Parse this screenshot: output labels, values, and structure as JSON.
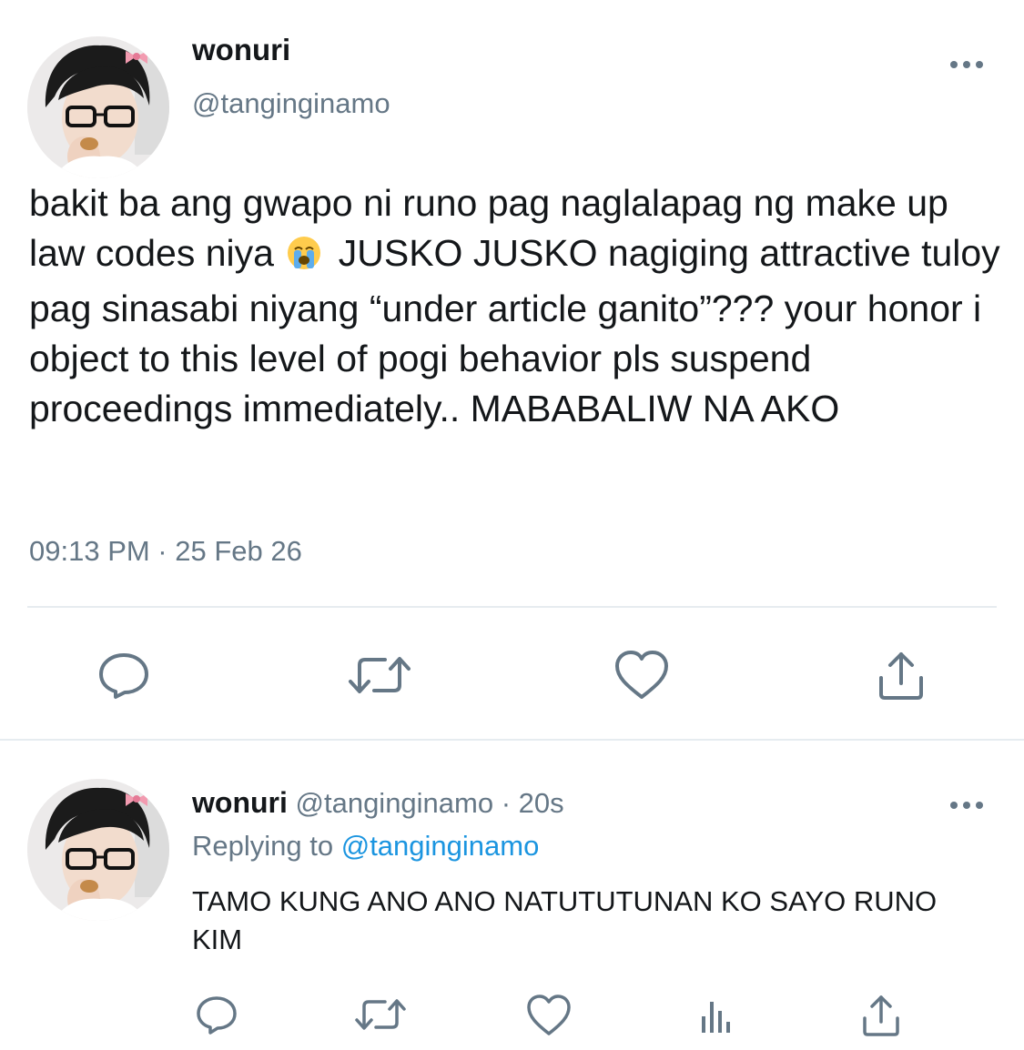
{
  "main_tweet": {
    "display_name": "wonuri",
    "handle": "@tanginginamo",
    "text_before_emoji": "bakit ba ang gwapo ni runo pag naglalapag ng make up law codes niya",
    "emoji": "😭",
    "text_after_emoji": "JUSKO JUSKO nagiging attractive tuloy pag sinasabi niyang “under article ganito”??? your honor i object to this level of pogi behavior pls suspend proceedings immediately.. MABABALIW NA AKO",
    "timestamp": "09:13 PM · 25 Feb 26"
  },
  "reply_tweet": {
    "display_name": "wonuri",
    "handle": "@tanginginamo",
    "separator_time": "· 20s",
    "replying_to_label": "Replying to",
    "replying_to_handle": "@tanginginamo",
    "text": "TAMO KUNG ANO ANO NATUTUTUNAN KO SAYO RUNO KIM"
  },
  "icons": {
    "more": "more-horizontal-icon",
    "reply": "reply-icon",
    "retweet": "retweet-icon",
    "like": "heart-icon",
    "analytics": "analytics-icon",
    "share": "share-icon"
  },
  "colors": {
    "text": "#14171a",
    "secondary": "#657786",
    "link": "#1b95e0",
    "divider": "#e6ecf0"
  }
}
